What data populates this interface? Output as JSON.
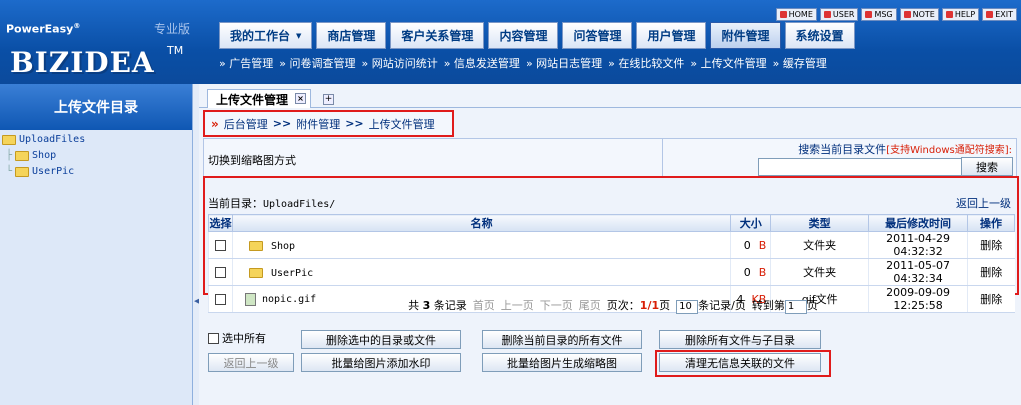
{
  "logo": {
    "brand_top": "PowerEasy",
    "reg": "®",
    "edition": "专业版",
    "name": "BIZIDEA",
    "tm": "TM"
  },
  "toplinks": [
    "HOME",
    "USER",
    "MSG",
    "NOTE",
    "HELP",
    "EXIT"
  ],
  "menu": [
    "我的工作台",
    "商店管理",
    "客户关系管理",
    "内容管理",
    "问答管理",
    "用户管理",
    "附件管理",
    "系统设置"
  ],
  "menu_dropdown_mark": "▼",
  "submenu": [
    "» 广告管理",
    "» 问卷调查管理",
    "» 网站访问统计",
    "» 信息发送管理",
    "» 网站日志管理",
    "» 在线比较文件",
    "» 上传文件管理",
    "» 缓存管理"
  ],
  "sidebar": {
    "title": "上传文件目录",
    "tree": [
      {
        "label": "UploadFiles",
        "level": 0
      },
      {
        "label": "Shop",
        "level": 1
      },
      {
        "label": "UserPic",
        "level": 1
      }
    ]
  },
  "tab": {
    "label": "上传文件管理",
    "close": "×",
    "add": "+"
  },
  "breadcrumb": {
    "marker": "»",
    "items": [
      "后台管理",
      "附件管理",
      "上传文件管理"
    ],
    "sep": ">>"
  },
  "view_switch": "切换到缩略图方式",
  "search": {
    "label": "搜索当前目录文件",
    "hint": "[支持Windows通配符搜索]:",
    "button": "搜索",
    "value": ""
  },
  "current_dir": {
    "label": "当前目录：",
    "path": "UploadFiles/",
    "up": "返回上一级"
  },
  "columns": [
    "选择",
    "名称",
    "大小",
    "类型",
    "最后修改时间",
    "操作"
  ],
  "files": [
    {
      "name": "Shop",
      "size": "0",
      "unit": "B",
      "type": "文件夹",
      "modified": "2011-04-29 04:32:32",
      "action": "删除",
      "kind": "folder"
    },
    {
      "name": "UserPic",
      "size": "0",
      "unit": "B",
      "type": "文件夹",
      "modified": "2011-05-07 04:32:34",
      "action": "删除",
      "kind": "folder"
    },
    {
      "name": "nopic.gif",
      "size": "4",
      "unit": "KB",
      "type": "gif文件",
      "modified": "2009-09-09 12:25:58",
      "action": "删除",
      "kind": "gif"
    }
  ],
  "pager": {
    "total_prefix": "共",
    "total": "3",
    "total_suffix": "条记录",
    "first": "首页",
    "prev": "上一页",
    "next": "下一页",
    "last": "尾页",
    "page_label": "页次：",
    "page": "1/1",
    "page_unit": "页",
    "per_page": "10",
    "per_page_suffix": "条记录/页",
    "goto_label": "转到第",
    "goto_value": "1",
    "goto_suffix": "页"
  },
  "actions": {
    "select_all": "选中所有",
    "delete_selected": "删除选中的目录或文件",
    "delete_all_current": "删除当前目录的所有文件",
    "delete_all_sub": "删除所有文件与子目录",
    "go_up": "返回上一级",
    "watermark": "批量给图片添加水印",
    "thumbnail": "批量给图片生成缩略图",
    "cleanup": "清理无信息关联的文件"
  }
}
